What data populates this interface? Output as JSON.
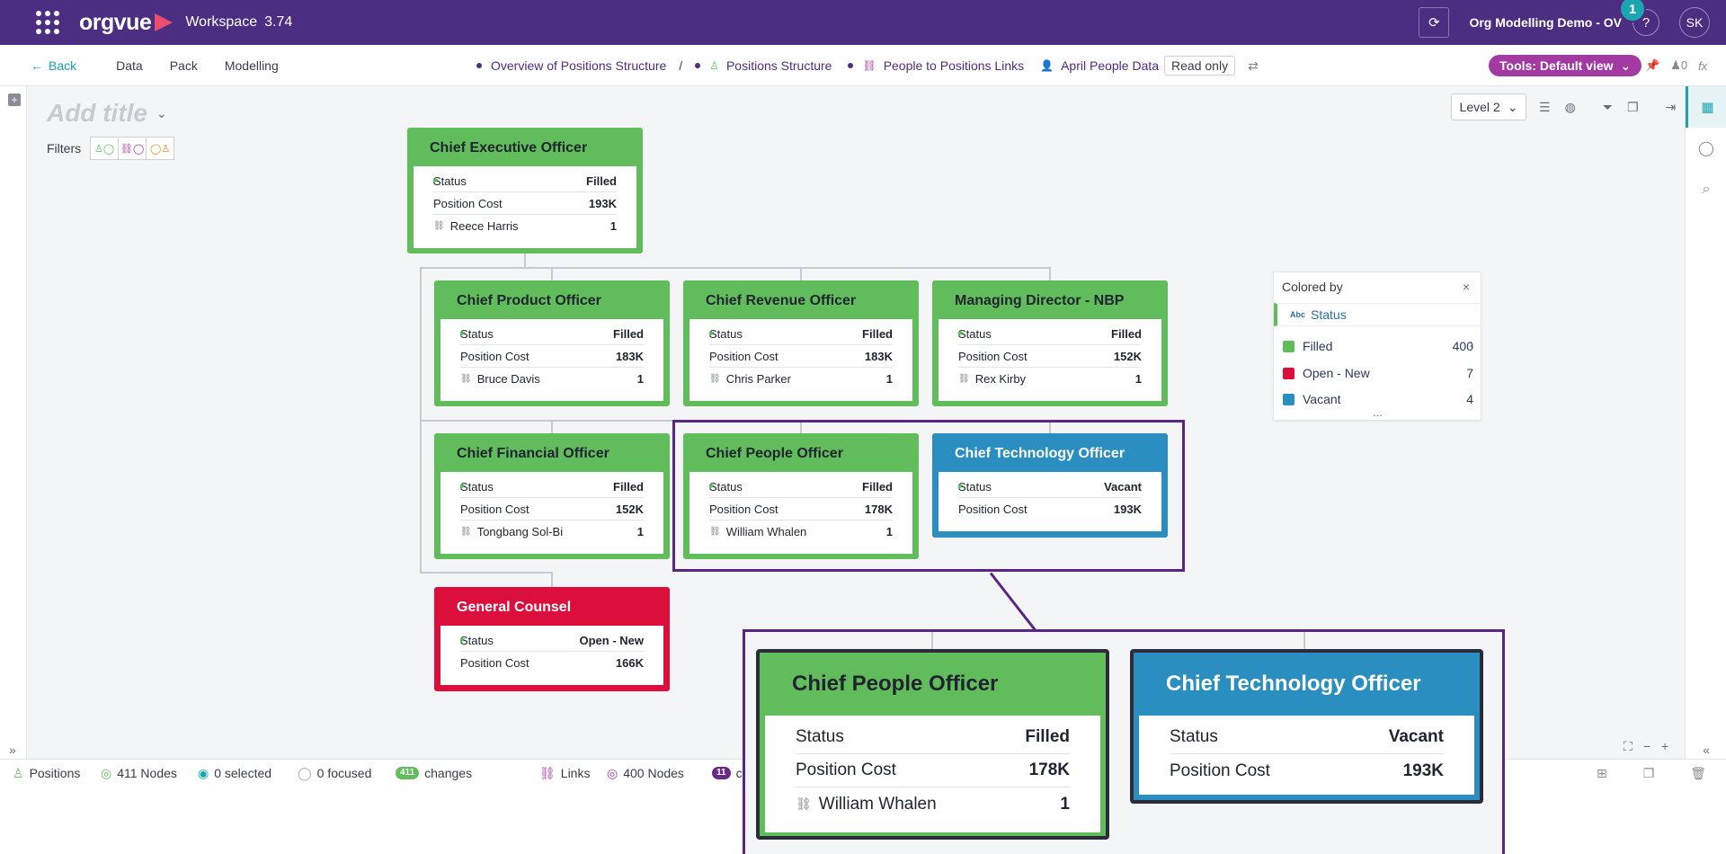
{
  "topbar": {
    "brand": "orgvue",
    "workspace_label": "Workspace",
    "workspace_version": "3.74",
    "project_name": "Org Modelling Demo - OV",
    "help_label": "?",
    "notification_count": "1",
    "user_initials": "SK",
    "colors": {
      "bg": "#4b2d82",
      "accent": "#1aa5b0"
    }
  },
  "toolbar": {
    "back_label": "Back",
    "nav": [
      "Data",
      "Pack",
      "Modelling"
    ],
    "breadcrumbs": [
      "Overview of Positions Structure",
      "Positions Structure",
      "People to Positions Links",
      "April People Data"
    ],
    "read_only_label": "Read only",
    "tools_label": "Tools: Default view",
    "people_count": "0",
    "fx_label": "fx"
  },
  "canvas": {
    "title_placeholder": "Add title",
    "filters_label": "Filters",
    "level_select": "Level 2"
  },
  "positions": [
    {
      "title": "Chief Executive Officer",
      "status": "Filled",
      "cost": "193K",
      "person": "Reece Harris",
      "person_count": "1"
    },
    {
      "title": "Chief Product Officer",
      "status": "Filled",
      "cost": "183K",
      "person": "Bruce Davis",
      "person_count": "1"
    },
    {
      "title": "Chief Revenue Officer",
      "status": "Filled",
      "cost": "183K",
      "person": "Chris Parker",
      "person_count": "1"
    },
    {
      "title": "Managing Director - NBP",
      "status": "Filled",
      "cost": "152K",
      "person": "Rex Kirby",
      "person_count": "1"
    },
    {
      "title": "Chief Financial Officer",
      "status": "Filled",
      "cost": "152K",
      "person": "Tongbang Sol-Bi",
      "person_count": "1"
    },
    {
      "title": "Chief People Officer",
      "status": "Filled",
      "cost": "178K",
      "person": "William Whalen",
      "person_count": "1"
    },
    {
      "title": "Chief Technology Officer",
      "status": "Vacant",
      "cost": "193K"
    },
    {
      "title": "General Counsel",
      "status": "Open - New",
      "cost": "166K"
    }
  ],
  "field_labels": {
    "status": "Status",
    "cost": "Position Cost"
  },
  "legend": {
    "title": "Colored by",
    "close": "×",
    "field_type": "Abc",
    "field": "Status",
    "items": [
      {
        "label": "Filled",
        "count": "400",
        "color": "#61bd5b"
      },
      {
        "label": "Open - New",
        "count": "7",
        "color": "#dc0f3c"
      },
      {
        "label": "Vacant",
        "count": "4",
        "color": "#2a8fc0"
      }
    ],
    "more": "..."
  },
  "statusbar": {
    "positions_label": "Positions",
    "nodes": "411 Nodes",
    "selected": "0 selected",
    "focused": "0 focused",
    "changes_count": "411",
    "changes_label": "changes",
    "links_label": "Links",
    "links_nodes": "400 Nodes",
    "links_changes_count": "11",
    "links_changes_label": "c"
  },
  "colors": {
    "filled": "#61bd5b",
    "vacant": "#2a8fc0",
    "open_new": "#dc0f3c",
    "highlight": "#5b2585"
  }
}
